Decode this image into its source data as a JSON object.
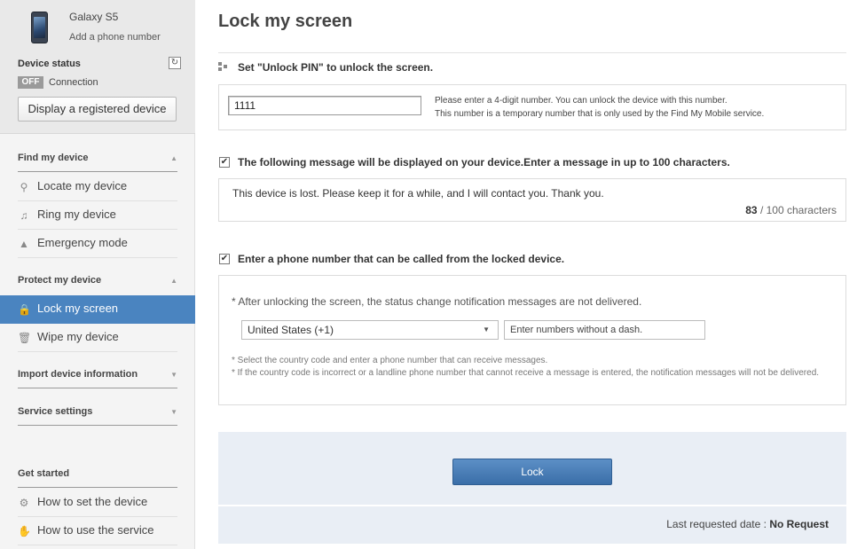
{
  "sidebar": {
    "device_name": "Galaxy S5",
    "add_phone": "Add a phone number",
    "status_title": "Device status",
    "status_badge": "OFF",
    "status_connection": "Connection",
    "display_button": "Display a registered device",
    "sections": {
      "find": {
        "title": "Find my device",
        "items": [
          "Locate my device",
          "Ring my device",
          "Emergency mode"
        ]
      },
      "protect": {
        "title": "Protect my device",
        "items": [
          "Lock my screen",
          "Wipe my device"
        ]
      },
      "import": {
        "title": "Import device information"
      },
      "service": {
        "title": "Service settings"
      },
      "started": {
        "title": "Get started",
        "items": [
          "How to set the device",
          "How to use the service"
        ]
      }
    }
  },
  "main": {
    "title": "Lock my screen",
    "pin": {
      "heading": "Set \"Unlock PIN\" to unlock the screen.",
      "value": "1111",
      "note_1": "Please enter a 4-digit number. You can unlock the device with this number.",
      "note_2": "This number is a temporary number that is only used by the Find My Mobile service."
    },
    "message": {
      "heading": "The following message will be displayed on your device.Enter a message in up to 100 characters.",
      "text": "This device is lost. Please keep it for a while, and I will contact you. Thank you.",
      "count": "83",
      "limit": " / 100 characters"
    },
    "phone": {
      "heading": "Enter a phone number that can be called from the locked device.",
      "note": "* After unlocking the screen, the status change notification messages are not delivered.",
      "country": "United States (+1)",
      "placeholder": "Enter numbers without a dash.",
      "hint_1": "* Select the country code and enter a phone number that can receive messages.",
      "hint_2": "* If the country code is incorrect or a landline phone number that cannot receive a message is entered, the notification messages will not be delivered."
    },
    "lock_button": "Lock",
    "last_requested_label": "Last requested date : ",
    "last_requested_value": "No Request"
  },
  "colors": {
    "accent": "#4a84c0",
    "button": "#3a6ea8",
    "panel": "#e9eef5"
  },
  "icons": [
    "phone-icon",
    "refresh-icon",
    "search-icon",
    "music-note-icon",
    "emergency-icon",
    "lock-icon",
    "trash-icon",
    "gear-icon",
    "hand-icon",
    "checkbox-icon"
  ]
}
